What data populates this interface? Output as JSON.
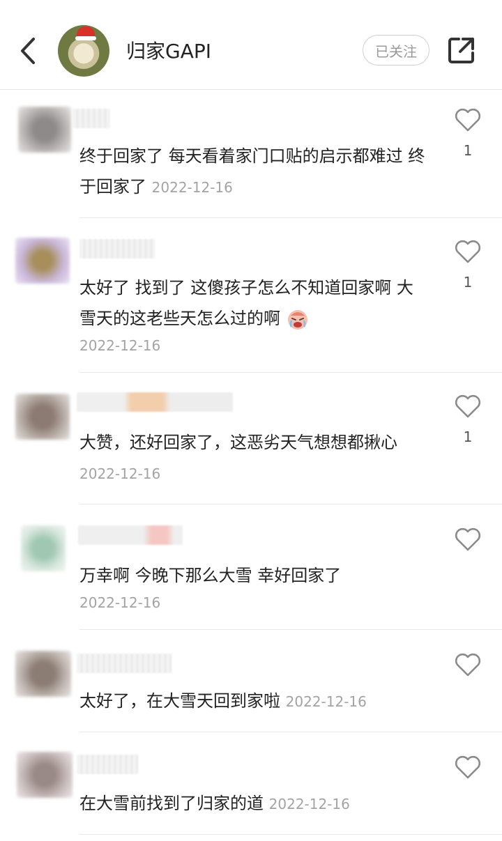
{
  "header": {
    "title": "归家GAPI",
    "follow_label": "已关注"
  },
  "comments": [
    {
      "text": "终于回家了 每天看着家门口贴的启示都难过 终于回家了",
      "date": "2022-12-16",
      "likes": "1"
    },
    {
      "text": "太好了 找到了 这傻孩子怎么不知道回家啊  大雪天的这老些天怎么过的啊",
      "date": "2022-12-16",
      "likes": "1",
      "emoji": "crying-face-emoji"
    },
    {
      "text": "大赞，还好回家了，这恶劣天气想想都揪心",
      "date": "2022-12-16",
      "likes": "1"
    },
    {
      "text": "万幸啊 今晚下那么大雪 幸好回家了",
      "date": "2022-12-16",
      "likes": ""
    },
    {
      "text": "太好了，在大雪天回到家啦",
      "date": "2022-12-16",
      "likes": ""
    },
    {
      "text": "在大雪前找到了归家的道",
      "date": "2022-12-16",
      "likes": ""
    }
  ],
  "colors": {
    "text": "#222222",
    "date": "#a3a3a3",
    "divider": "#e8e8e8",
    "heart": "#8a8a8a"
  },
  "icons": [
    "back-arrow-icon",
    "share-icon",
    "heart-icon",
    "crying-face-emoji"
  ]
}
